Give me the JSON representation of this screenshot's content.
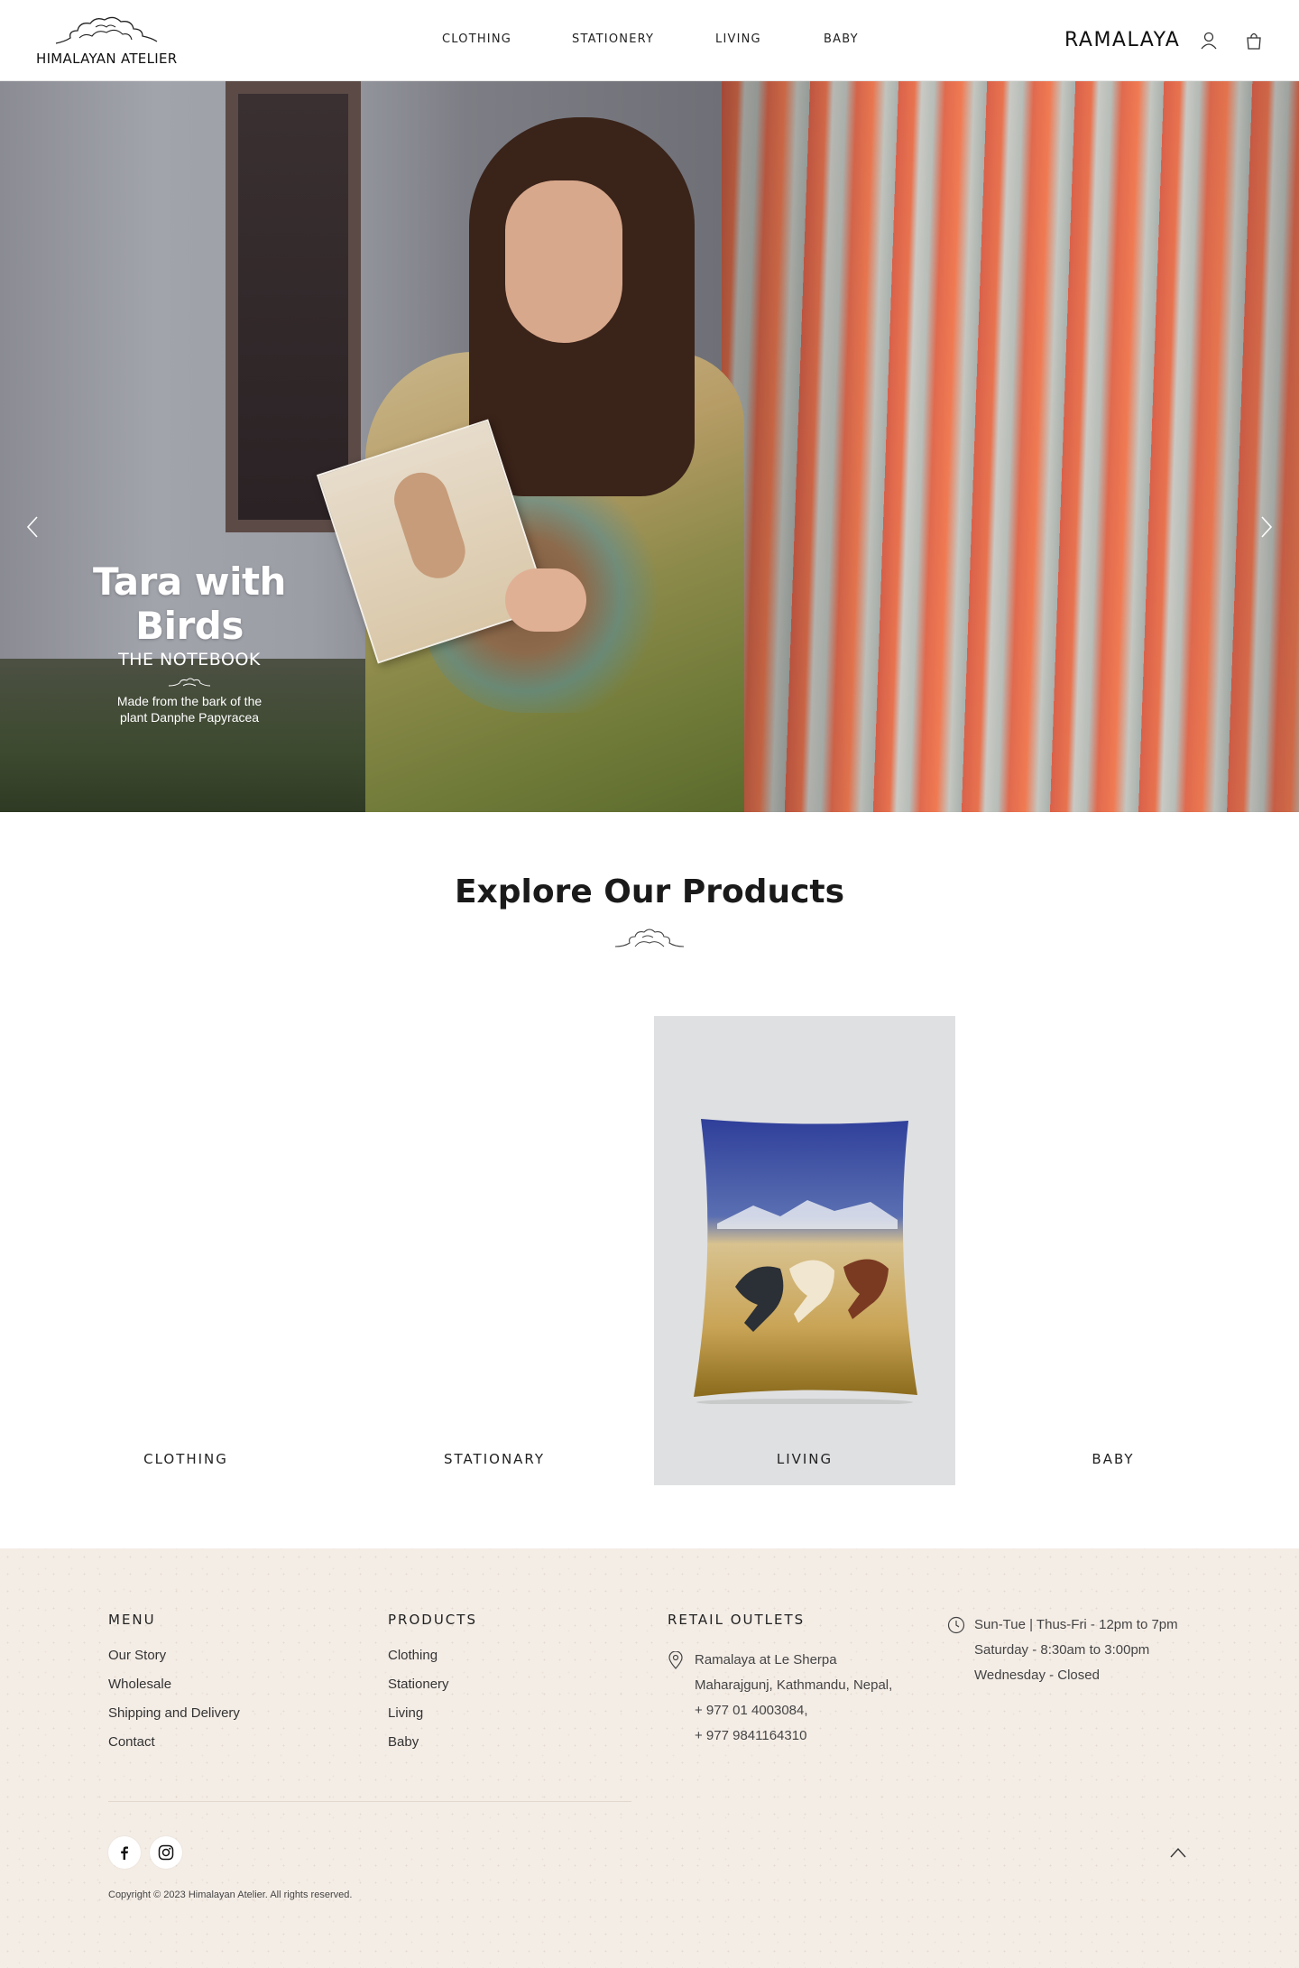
{
  "header": {
    "logo_text": "HIMALAYAN ATELIER",
    "nav": [
      {
        "label": "CLOTHING"
      },
      {
        "label": "STATIONERY"
      },
      {
        "label": "LIVING"
      },
      {
        "label": "BABY"
      }
    ],
    "brand_right": "RAMALAYA",
    "icons": [
      "account-icon",
      "shopping-bag-icon"
    ]
  },
  "hero": {
    "title": "Tara with Birds",
    "subtitle": "THE NOTEBOOK",
    "description_line1": "Made from the bark of the",
    "description_line2": "plant Danphe Papyracea",
    "prev_icon": "chevron-left-icon",
    "next_icon": "chevron-right-icon"
  },
  "products": {
    "title": "Explore Our Products",
    "categories": [
      {
        "label": "CLOTHING"
      },
      {
        "label": "STATIONARY"
      },
      {
        "label": "LIVING"
      },
      {
        "label": "BABY"
      }
    ]
  },
  "footer": {
    "menu": {
      "heading": "MENU",
      "items": [
        "Our Story",
        "Wholesale",
        "Shipping and Delivery",
        "Contact"
      ]
    },
    "products": {
      "heading": "PRODUCTS",
      "items": [
        "Clothing",
        "Stationery",
        "Living",
        "Baby"
      ]
    },
    "retail": {
      "heading": "RETAIL OUTLETS",
      "lines": [
        "Ramalaya at Le Sherpa",
        "Maharajgunj, Kathmandu, Nepal,",
        "+ 977 01 4003084,",
        "+ 977 9841164310"
      ]
    },
    "hours": {
      "lines": [
        "Sun-Tue | Thus-Fri - 12pm to 7pm",
        "Saturday - 8:30am to 3:00pm",
        "Wednesday - Closed"
      ]
    },
    "copyright": "Copyright © 2023 Himalayan Atelier. All rights reserved.",
    "social_icons": [
      "facebook-icon",
      "instagram-icon"
    ],
    "back_to_top_icon": "chevron-up-icon"
  }
}
